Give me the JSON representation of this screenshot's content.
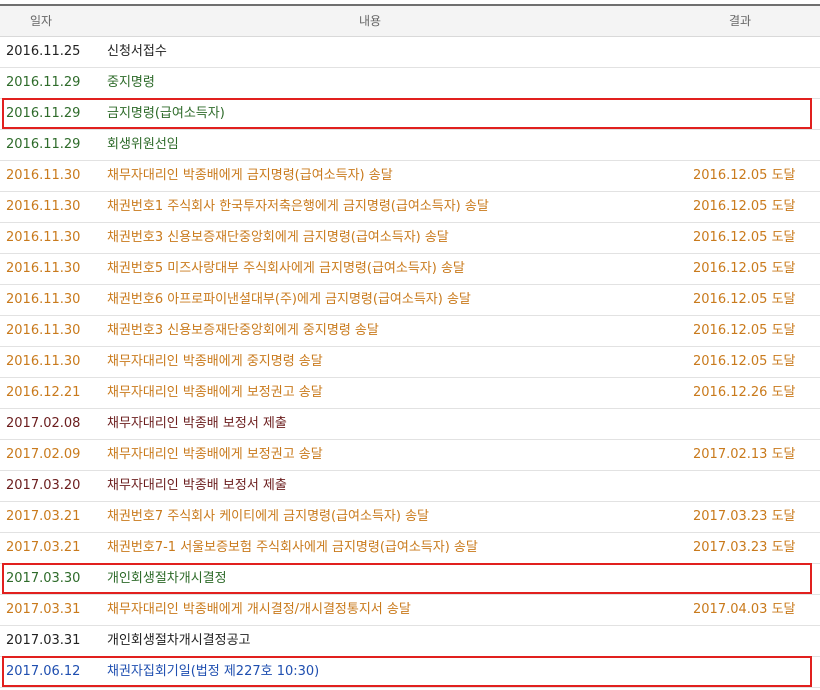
{
  "header": {
    "date": "일자",
    "content": "내용",
    "result": "결과"
  },
  "colors": {
    "black": "#222222",
    "green": "#2e6b2a",
    "orange": "#c97a1c",
    "maroon": "#6b1d1d",
    "blue": "#1f4fb0",
    "highlight": "#e1201e"
  },
  "rows": [
    {
      "date": "2016.11.25",
      "content": "신청서접수",
      "result": "",
      "color": "#222222",
      "highlight": false
    },
    {
      "date": "2016.11.29",
      "content": "중지명령",
      "result": "",
      "color": "#2e6b2a",
      "highlight": false
    },
    {
      "date": "2016.11.29",
      "content": "금지명령(급여소득자)",
      "result": "",
      "color": "#2e6b2a",
      "highlight": true
    },
    {
      "date": "2016.11.29",
      "content": "회생위원선임",
      "result": "",
      "color": "#2e6b2a",
      "highlight": false
    },
    {
      "date": "2016.11.30",
      "content": "채무자대리인 박종배에게 금지명령(급여소득자) 송달",
      "result": "2016.12.05 도달",
      "color": "#c97a1c",
      "highlight": false
    },
    {
      "date": "2016.11.30",
      "content": "채권번호1 주식회사 한국투자저축은행에게 금지명령(급여소득자) 송달",
      "result": "2016.12.05 도달",
      "color": "#c97a1c",
      "highlight": false
    },
    {
      "date": "2016.11.30",
      "content": "채권번호3 신용보증재단중앙회에게 금지명령(급여소득자) 송달",
      "result": "2016.12.05 도달",
      "color": "#c97a1c",
      "highlight": false
    },
    {
      "date": "2016.11.30",
      "content": "채권번호5 미즈사랑대부 주식회사에게 금지명령(급여소득자) 송달",
      "result": "2016.12.05 도달",
      "color": "#c97a1c",
      "highlight": false
    },
    {
      "date": "2016.11.30",
      "content": "채권번호6 아프로파이낸셜대부(주)에게 금지명령(급여소득자) 송달",
      "result": "2016.12.05 도달",
      "color": "#c97a1c",
      "highlight": false
    },
    {
      "date": "2016.11.30",
      "content": "채권번호3 신용보증재단중앙회에게 중지명령 송달",
      "result": "2016.12.05 도달",
      "color": "#c97a1c",
      "highlight": false
    },
    {
      "date": "2016.11.30",
      "content": "채무자대리인 박종배에게 중지명령 송달",
      "result": "2016.12.05 도달",
      "color": "#c97a1c",
      "highlight": false
    },
    {
      "date": "2016.12.21",
      "content": "채무자대리인 박종배에게 보정권고 송달",
      "result": "2016.12.26 도달",
      "color": "#c97a1c",
      "highlight": false
    },
    {
      "date": "2017.02.08",
      "content": "채무자대리인 박종배 보정서 제출",
      "result": "",
      "color": "#6b1d1d",
      "highlight": false
    },
    {
      "date": "2017.02.09",
      "content": "채무자대리인 박종배에게 보정권고 송달",
      "result": "2017.02.13 도달",
      "color": "#c97a1c",
      "highlight": false
    },
    {
      "date": "2017.03.20",
      "content": "채무자대리인 박종배 보정서 제출",
      "result": "",
      "color": "#6b1d1d",
      "highlight": false
    },
    {
      "date": "2017.03.21",
      "content": "채권번호7 주식회사 케이티에게 금지명령(급여소득자) 송달",
      "result": "2017.03.23 도달",
      "color": "#c97a1c",
      "highlight": false
    },
    {
      "date": "2017.03.21",
      "content": "채권번호7-1 서울보증보험 주식회사에게 금지명령(급여소득자) 송달",
      "result": "2017.03.23 도달",
      "color": "#c97a1c",
      "highlight": false
    },
    {
      "date": "2017.03.30",
      "content": "개인회생절차개시결정",
      "result": "",
      "color": "#2e6b2a",
      "highlight": true
    },
    {
      "date": "2017.03.31",
      "content": "채무자대리인 박종배에게 개시결정/개시결정통지서 송달",
      "result": "2017.04.03 도달",
      "color": "#c97a1c",
      "highlight": false
    },
    {
      "date": "2017.03.31",
      "content": "개인회생절차개시결정공고",
      "result": "",
      "color": "#222222",
      "highlight": false
    },
    {
      "date": "2017.06.12",
      "content": "채권자집회기일(법정 제227호 10:30)",
      "result": "",
      "color": "#1f4fb0",
      "highlight": true
    }
  ]
}
